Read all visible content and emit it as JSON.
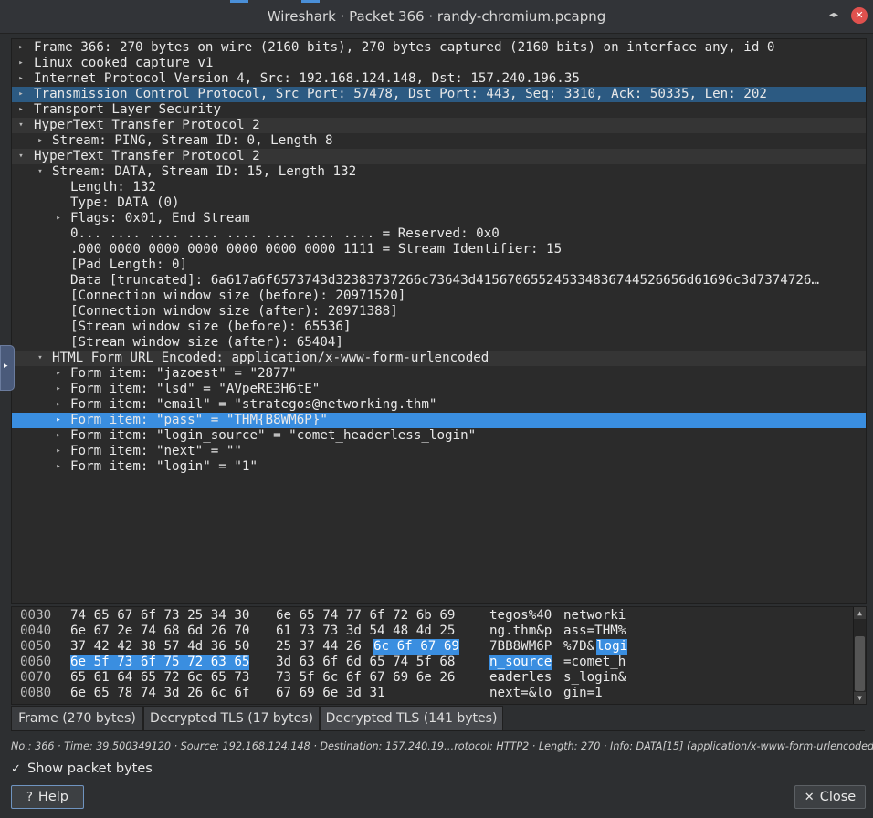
{
  "window": {
    "title": "Wireshark · Packet 366 · randy-chromium.pcapng",
    "min_icon": "minimize-icon",
    "max_icon": "maximize-icon",
    "close_icon": "close-icon"
  },
  "tree": {
    "rows": [
      {
        "text": "Frame 366: 270 bytes on wire (2160 bits), 270 bytes captured (2160 bits) on interface any, id 0",
        "arrow": "▸"
      },
      {
        "text": "Linux cooked capture v1",
        "arrow": "▸"
      },
      {
        "text": "Internet Protocol Version 4, Src: 192.168.124.148, Dst: 157.240.196.35",
        "arrow": "▸"
      },
      {
        "text": "Transmission Control Protocol, Src Port: 57478, Dst Port: 443, Seq: 3310, Ack: 50335, Len: 202",
        "arrow": "▸"
      },
      {
        "text": "Transport Layer Security",
        "arrow": "▸"
      },
      {
        "text": "HyperText Transfer Protocol 2",
        "arrow": "▾"
      },
      {
        "text": "Stream: PING, Stream ID: 0, Length 8",
        "arrow": "▸"
      },
      {
        "text": "HyperText Transfer Protocol 2",
        "arrow": "▾"
      },
      {
        "text": "Stream: DATA, Stream ID: 15, Length 132",
        "arrow": "▾"
      },
      {
        "text": "Length: 132",
        "arrow": ""
      },
      {
        "text": "Type: DATA (0)",
        "arrow": ""
      },
      {
        "text": "Flags: 0x01, End Stream",
        "arrow": "▸"
      },
      {
        "text": "0... .... .... .... .... .... .... .... = Reserved: 0x0",
        "arrow": ""
      },
      {
        "text": ".000 0000 0000 0000 0000 0000 0000 1111 = Stream Identifier: 15",
        "arrow": ""
      },
      {
        "text": "[Pad Length: 0]",
        "arrow": ""
      },
      {
        "text": "Data [truncated]: 6a617a6f6573743d32383737266c73643d415670655245334836744526656d61696c3d7374726…",
        "arrow": ""
      },
      {
        "text": "[Connection window size (before): 20971520]",
        "arrow": ""
      },
      {
        "text": "[Connection window size (after): 20971388]",
        "arrow": ""
      },
      {
        "text": "[Stream window size (before): 65536]",
        "arrow": ""
      },
      {
        "text": "[Stream window size (after): 65404]",
        "arrow": ""
      },
      {
        "text": "HTML Form URL Encoded: application/x-www-form-urlencoded",
        "arrow": "▾"
      },
      {
        "text": "Form item: \"jazoest\" = \"2877\"",
        "arrow": "▸"
      },
      {
        "text": "Form item: \"lsd\" = \"AVpeRE3H6tE\"",
        "arrow": "▸"
      },
      {
        "text": "Form item: \"email\" = \"strategos@networking.thm\"",
        "arrow": "▸"
      },
      {
        "text": "Form item: \"pass\" = \"THM{B8WM6P}\"",
        "arrow": "▸"
      },
      {
        "text": "Form item: \"login_source\" = \"comet_headerless_login\"",
        "arrow": "▸"
      },
      {
        "text": "Form item: \"next\" = \"\"",
        "arrow": "▸"
      },
      {
        "text": "Form item: \"login\" = \"1\"",
        "arrow": "▸"
      }
    ]
  },
  "hex": {
    "rows": [
      {
        "offset": "0030",
        "a": "74 65 67 6f 73 25 34 30",
        "b": "6e 65 74 77 6f 72 6b 69",
        "c": "tegos%40",
        "d": "networki"
      },
      {
        "offset": "0040",
        "a": "6e 67 2e 74 68 6d 26 70",
        "b": "61 73 73 3d 54 48 4d 25",
        "c": "ng.thm&p",
        "d": "ass=THM%"
      },
      {
        "offset": "0050",
        "a": "37 42 42 38 57 4d 36 50",
        "b": "25 37 44 26",
        "b_hl": "6c 6f 67 69",
        "c": "7BB8WM6P",
        "d": "%7D&",
        "d_hl": "logi"
      },
      {
        "offset": "0060",
        "a_hl": "6e 5f 73 6f 75 72 63 65",
        "b": "3d 63 6f 6d 65 74 5f 68",
        "c_hl": "n_source",
        "d": "=comet_h"
      },
      {
        "offset": "0070",
        "a": "65 61 64 65 72 6c 65 73",
        "b": "73 5f 6c 6f 67 69 6e 26",
        "c": "eaderles",
        "d": "s_login&"
      },
      {
        "offset": "0080",
        "a": "6e 65 78 74 3d 26 6c 6f",
        "b": "67 69 6e 3d 31",
        "c": "next=&lo",
        "d": "gin=1"
      }
    ]
  },
  "tabs": [
    {
      "label": "Frame (270 bytes)"
    },
    {
      "label": "Decrypted TLS (17 bytes)"
    },
    {
      "label": "Decrypted TLS (141 bytes)"
    }
  ],
  "status": "No.: 366 · Time: 39.500349120 · Source: 192.168.124.148 · Destination: 157.240.19…rotocol: HTTP2 · Length: 270 · Info: DATA[15] (application/x-www-form-urlencoded)",
  "show_bytes": {
    "label": "Show packet bytes",
    "checked": true
  },
  "buttons": {
    "help": "Help",
    "close_pre": "",
    "close_u": "C",
    "close_post": "lose"
  }
}
